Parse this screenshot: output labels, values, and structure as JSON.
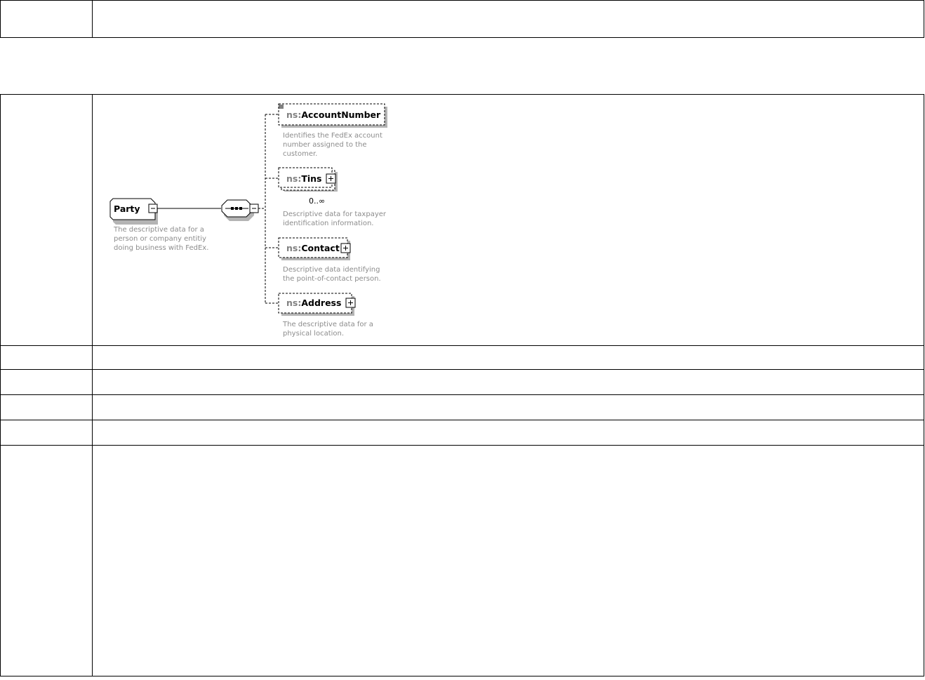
{
  "diagram": {
    "root": {
      "name": "Party",
      "doc": [
        "The descriptive data for a",
        "person or company entitiy",
        "doing business with FedEx."
      ]
    },
    "sequence_icon": "sequence-compositor",
    "children": [
      {
        "prefix": "ns:",
        "name": "AccountNumber",
        "occurrence": "",
        "doc": [
          "Identifies the FedEx account",
          "number assigned to the",
          "customer."
        ]
      },
      {
        "prefix": "ns:",
        "name": "Tins",
        "occurrence": "0..∞",
        "doc": [
          "Descriptive data for taxpayer",
          "identification information."
        ]
      },
      {
        "prefix": "ns:",
        "name": "Contact",
        "occurrence": "",
        "doc": [
          "Descriptive data identifying",
          "the point-of-contact person."
        ]
      },
      {
        "prefix": "ns:",
        "name": "Address",
        "occurrence": "",
        "doc": [
          "The descriptive data for a",
          "physical location."
        ]
      }
    ]
  },
  "colors": {
    "border": "#000000",
    "shadow": "#b4b4b4",
    "doc_text": "#8c8c8c",
    "prefix_text": "#808080"
  }
}
